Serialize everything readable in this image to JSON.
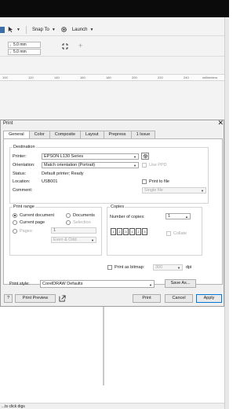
{
  "app": {
    "toolbar": {
      "snap_to_label": "Snap To",
      "launch_label": "Launch"
    },
    "property_bar": {
      "width_value": "5.0 mm",
      "height_value": "5.0 mm"
    },
    "ruler": {
      "tick_labels": [
        "100",
        "120",
        "140",
        "160",
        "180",
        "200",
        "220",
        "240"
      ],
      "units": "millimeters"
    }
  },
  "dialog": {
    "title": "Print",
    "tabs": [
      "General",
      "Color",
      "Composite",
      "Layout",
      "Prepress",
      "1 Issue"
    ],
    "active_tab": "General",
    "destination": {
      "group_title": "Destination",
      "printer_label": "Printer:",
      "printer_value": "EPSON L130 Series",
      "orientation_label": "Orientation:",
      "orientation_value": "Match orientation (Portrait)",
      "use_ppd_label": "Use PPD",
      "status_label": "Status:",
      "status_value": "Default printer; Ready",
      "location_label": "Location:",
      "location_value": "USB001",
      "print_to_file_label": "Print to file",
      "comment_label": "Comment:",
      "single_file_value": "Single file"
    },
    "print_range": {
      "group_title": "Print range",
      "current_document": "Current document",
      "documents": "Documents",
      "current_page": "Current page",
      "selection": "Selection",
      "pages": "Pages:",
      "pages_value": "1",
      "even_odd_value": "Even & Odd"
    },
    "copies": {
      "group_title": "Copies",
      "number_label": "Number of copies:",
      "number_value": "1",
      "collate_label": "Collate"
    },
    "print_as_bitmap_label": "Print as bitmap:",
    "bitmap_dpi_value": "300",
    "dpi_label": "dpi",
    "print_style_label": "Print style:",
    "print_style_value": "CorelDRAW Defaults",
    "save_as_label": "Save As...",
    "help_label": "?",
    "print_preview_label": "Print Preview",
    "print_label": "Print",
    "cancel_label": "Cancel",
    "apply_label": "Apply"
  },
  "status_bar": {
    "text": "...ts click digs"
  }
}
